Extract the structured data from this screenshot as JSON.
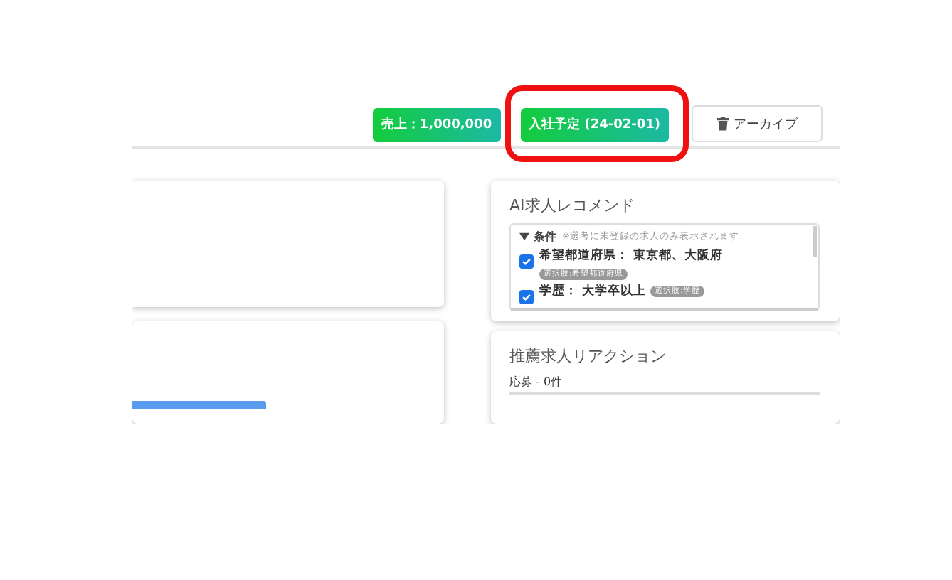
{
  "header": {
    "badges": [
      {
        "label": "売上：1,000,000",
        "highlighted": false
      },
      {
        "label": "入社予定 (24-02-01)",
        "highlighted": true
      }
    ],
    "archive_button": {
      "label": "アーカイブ"
    }
  },
  "recommend": {
    "title": "AI求人レコメンド",
    "conditions": {
      "expanded": true,
      "label": "条件",
      "note": "※選考に未登録の求人のみ表示されます",
      "items": [
        {
          "label": "希望都道府県： 東京都、大阪府",
          "checked": true,
          "tag": "選択肢:希望都道府県"
        },
        {
          "label": "学歴： 大学卒以上",
          "checked": true,
          "tag": "選択肢:学歴"
        }
      ]
    }
  },
  "reaction": {
    "title": "推薦求人リアクション",
    "rows": [
      "応募 - 0件"
    ]
  }
}
